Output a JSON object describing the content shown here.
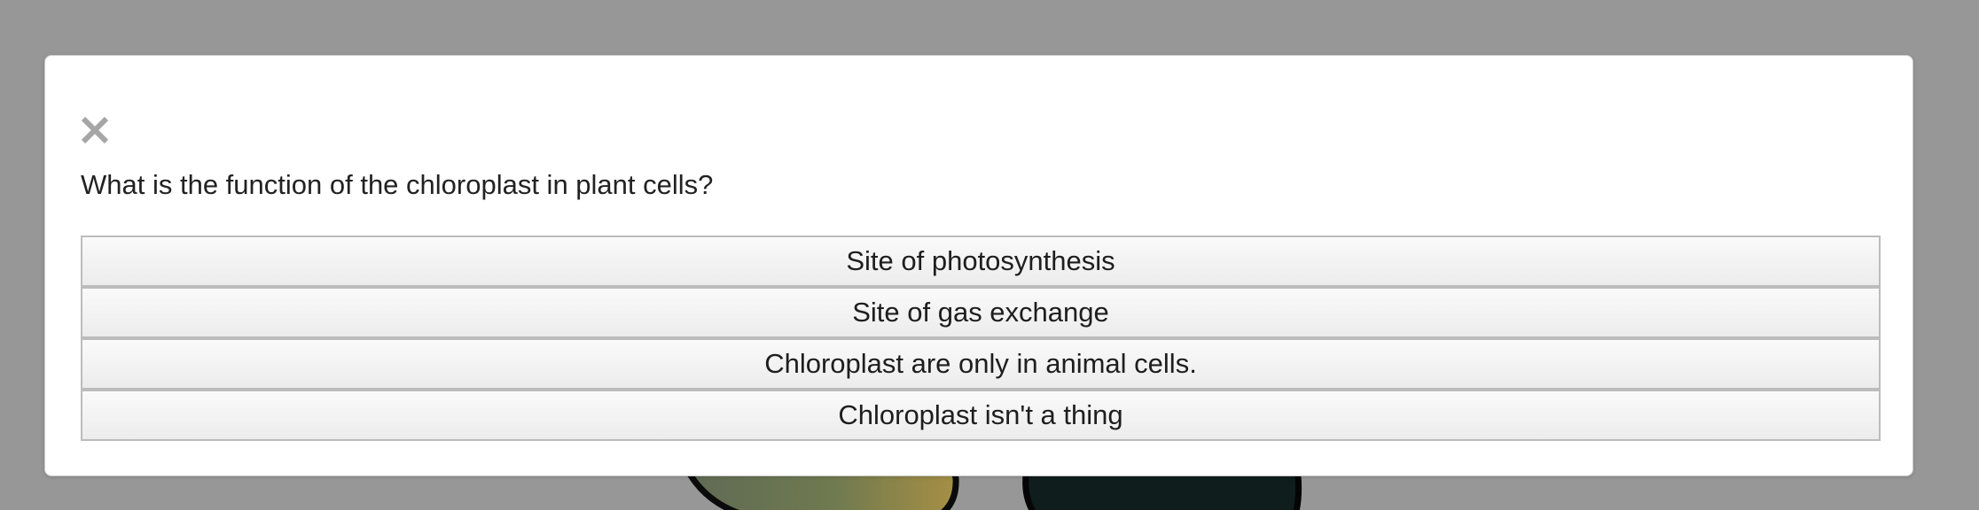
{
  "quiz": {
    "question": "What is the function of the chloroplast in plant cells?",
    "options": [
      {
        "label": "Site of photosynthesis"
      },
      {
        "label": "Site of gas exchange"
      },
      {
        "label": "Chloroplast are only in animal cells."
      },
      {
        "label": "Chloroplast isn't a thing"
      }
    ],
    "close_icon": "close-icon"
  },
  "colors": {
    "overlay": "#979797",
    "modal_background": "#ffffff",
    "option_border": "#bcbcbc",
    "text": "#222222",
    "close_icon": "#a6a6a6"
  }
}
